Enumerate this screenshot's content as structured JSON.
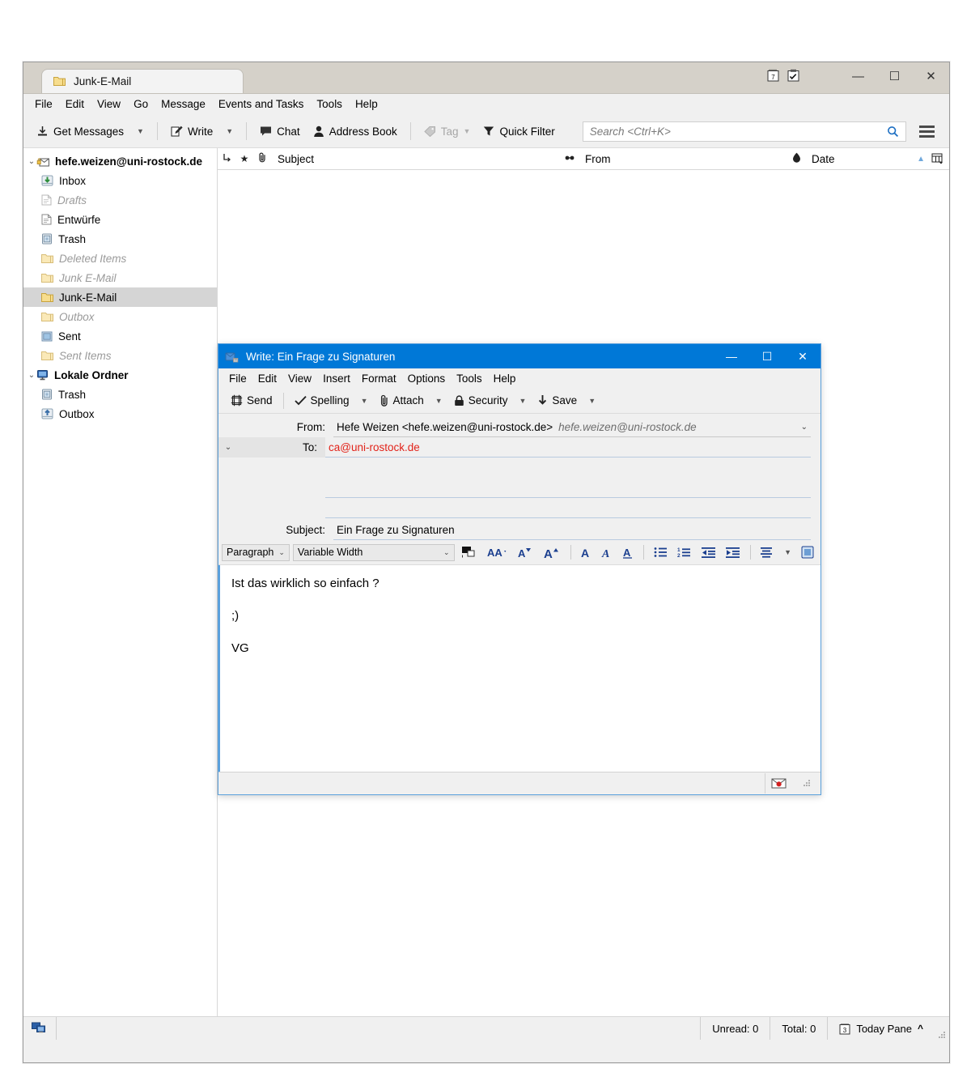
{
  "main_window": {
    "tab": {
      "label": "Junk-E-Mail",
      "icon": "folder-icon"
    },
    "titlebar_icons": [
      {
        "name": "calendar-icon",
        "glyph": "7"
      },
      {
        "name": "tasks-icon",
        "glyph": "✓"
      }
    ],
    "window_controls": {
      "minimize": "—",
      "maximize": "☐",
      "close": "✕"
    },
    "menubar": [
      {
        "label": "File",
        "accel": "F"
      },
      {
        "label": "Edit",
        "accel": "E"
      },
      {
        "label": "View",
        "accel": "V"
      },
      {
        "label": "Go",
        "accel": "G"
      },
      {
        "label": "Message",
        "accel": "M"
      },
      {
        "label": "Events and Tasks",
        "accel": "n"
      },
      {
        "label": "Tools",
        "accel": "T"
      },
      {
        "label": "Help",
        "accel": "H"
      }
    ],
    "toolbar": {
      "get_messages": "Get Messages",
      "write": "Write",
      "chat": "Chat",
      "address_book": "Address Book",
      "tag": "Tag",
      "quick_filter": "Quick Filter",
      "menu_button": "app-menu-icon"
    },
    "search": {
      "placeholder": "Search <Ctrl+K>",
      "value": "",
      "icon": "search-icon"
    },
    "folder_pane": [
      {
        "label": "hefe.weizen@uni-rostock.de",
        "level": 0,
        "style": "bold",
        "icon": "account-icon",
        "twisty": "v"
      },
      {
        "label": "Inbox",
        "level": 1,
        "style": "normal",
        "icon": "inbox-icon"
      },
      {
        "label": "Drafts",
        "level": 1,
        "style": "dim",
        "icon": "drafts-icon"
      },
      {
        "label": "Entwürfe",
        "level": 1,
        "style": "normal",
        "icon": "drafts-icon"
      },
      {
        "label": "Trash",
        "level": 1,
        "style": "normal",
        "icon": "trash-icon"
      },
      {
        "label": "Deleted Items",
        "level": 1,
        "style": "dim",
        "icon": "folder-icon"
      },
      {
        "label": "Junk E-Mail",
        "level": 1,
        "style": "dim",
        "icon": "folder-icon"
      },
      {
        "label": "Junk-E-Mail",
        "level": 1,
        "style": "selected",
        "icon": "folder-icon"
      },
      {
        "label": "Outbox",
        "level": 1,
        "style": "dim",
        "icon": "folder-icon"
      },
      {
        "label": "Sent",
        "level": 1,
        "style": "normal",
        "icon": "sent-icon"
      },
      {
        "label": "Sent Items",
        "level": 1,
        "style": "dim",
        "icon": "folder-icon"
      },
      {
        "label": "Lokale Ordner",
        "level": 0,
        "style": "bold",
        "icon": "local-folders-icon",
        "twisty": "v"
      },
      {
        "label": "Trash",
        "level": 1,
        "style": "normal",
        "icon": "trash-icon"
      },
      {
        "label": "Outbox",
        "level": 1,
        "style": "normal",
        "icon": "outbox-icon"
      }
    ],
    "message_list": {
      "columns": [
        {
          "label": "",
          "icon": "thread-icon"
        },
        {
          "label": "",
          "icon": "star-icon"
        },
        {
          "label": "",
          "icon": "attachment-icon"
        },
        {
          "label": "Subject",
          "icon": ""
        },
        {
          "label": "From",
          "icon": "read-icon"
        },
        {
          "label": "Date",
          "icon": "junk-icon"
        }
      ],
      "sort_indicator": "▲",
      "column_picker": "column-picker-icon",
      "rows": []
    },
    "statusbar": {
      "network_icon": "network-status-icon",
      "unread": "Unread: 0",
      "total": "Total: 0",
      "today_pane": "Today Pane",
      "today_pane_icon": "calendar-3-icon",
      "today_pane_chevron": "^"
    }
  },
  "compose_window": {
    "title": "Write: Ein Frage zu Signaturen",
    "title_icon": "compose-icon",
    "window_controls": {
      "minimize": "—",
      "maximize": "☐",
      "close": "✕"
    },
    "accent_color": "#0078d7",
    "menubar": [
      {
        "label": "File",
        "accel": "F"
      },
      {
        "label": "Edit",
        "accel": "E"
      },
      {
        "label": "View",
        "accel": "V"
      },
      {
        "label": "Insert",
        "accel": "I"
      },
      {
        "label": "Format",
        "accel": "o"
      },
      {
        "label": "Options",
        "accel": "p"
      },
      {
        "label": "Tools",
        "accel": "T"
      },
      {
        "label": "Help",
        "accel": "H"
      }
    ],
    "toolbar": {
      "send": "Send",
      "spelling": "Spelling",
      "attach": "Attach",
      "security": "Security",
      "save": "Save"
    },
    "fields": {
      "from_label": "From:",
      "from_value": "Hefe Weizen <hefe.weizen@uni-rostock.de>",
      "from_identity": "hefe.weizen@uni-rostock.de",
      "to_label": "To:",
      "to_value": "ca@uni-rostock.de",
      "subject_label": "Subject:",
      "subject_value": "Ein Frage zu Signaturen",
      "recipient_color": "#e2231a"
    },
    "format_toolbar": {
      "paragraph_style": "Paragraph",
      "font_family": "Variable Width",
      "buttons": [
        {
          "name": "text-color-swatch",
          "glyph": "■"
        },
        {
          "name": "highlight-color-icon",
          "glyph": "AA"
        },
        {
          "name": "decrease-font-size-icon",
          "glyph": "A▾"
        },
        {
          "name": "increase-font-size-icon",
          "glyph": "A▴"
        },
        {
          "name": "bold-icon",
          "glyph": "A"
        },
        {
          "name": "italic-icon",
          "glyph": "A"
        },
        {
          "name": "underline-icon",
          "glyph": "A"
        },
        {
          "name": "bullet-list-icon",
          "glyph": "≔"
        },
        {
          "name": "numbered-list-icon",
          "glyph": "⅟≡"
        },
        {
          "name": "decrease-indent-icon",
          "glyph": "⇤"
        },
        {
          "name": "increase-indent-icon",
          "glyph": "⇥"
        },
        {
          "name": "align-icon",
          "glyph": "≡"
        },
        {
          "name": "insert-icon",
          "glyph": "▣"
        }
      ]
    },
    "body": [
      "Ist das wirklich so einfach ?",
      ";)",
      "VG"
    ],
    "status_icon": "offline-mail-icon"
  }
}
